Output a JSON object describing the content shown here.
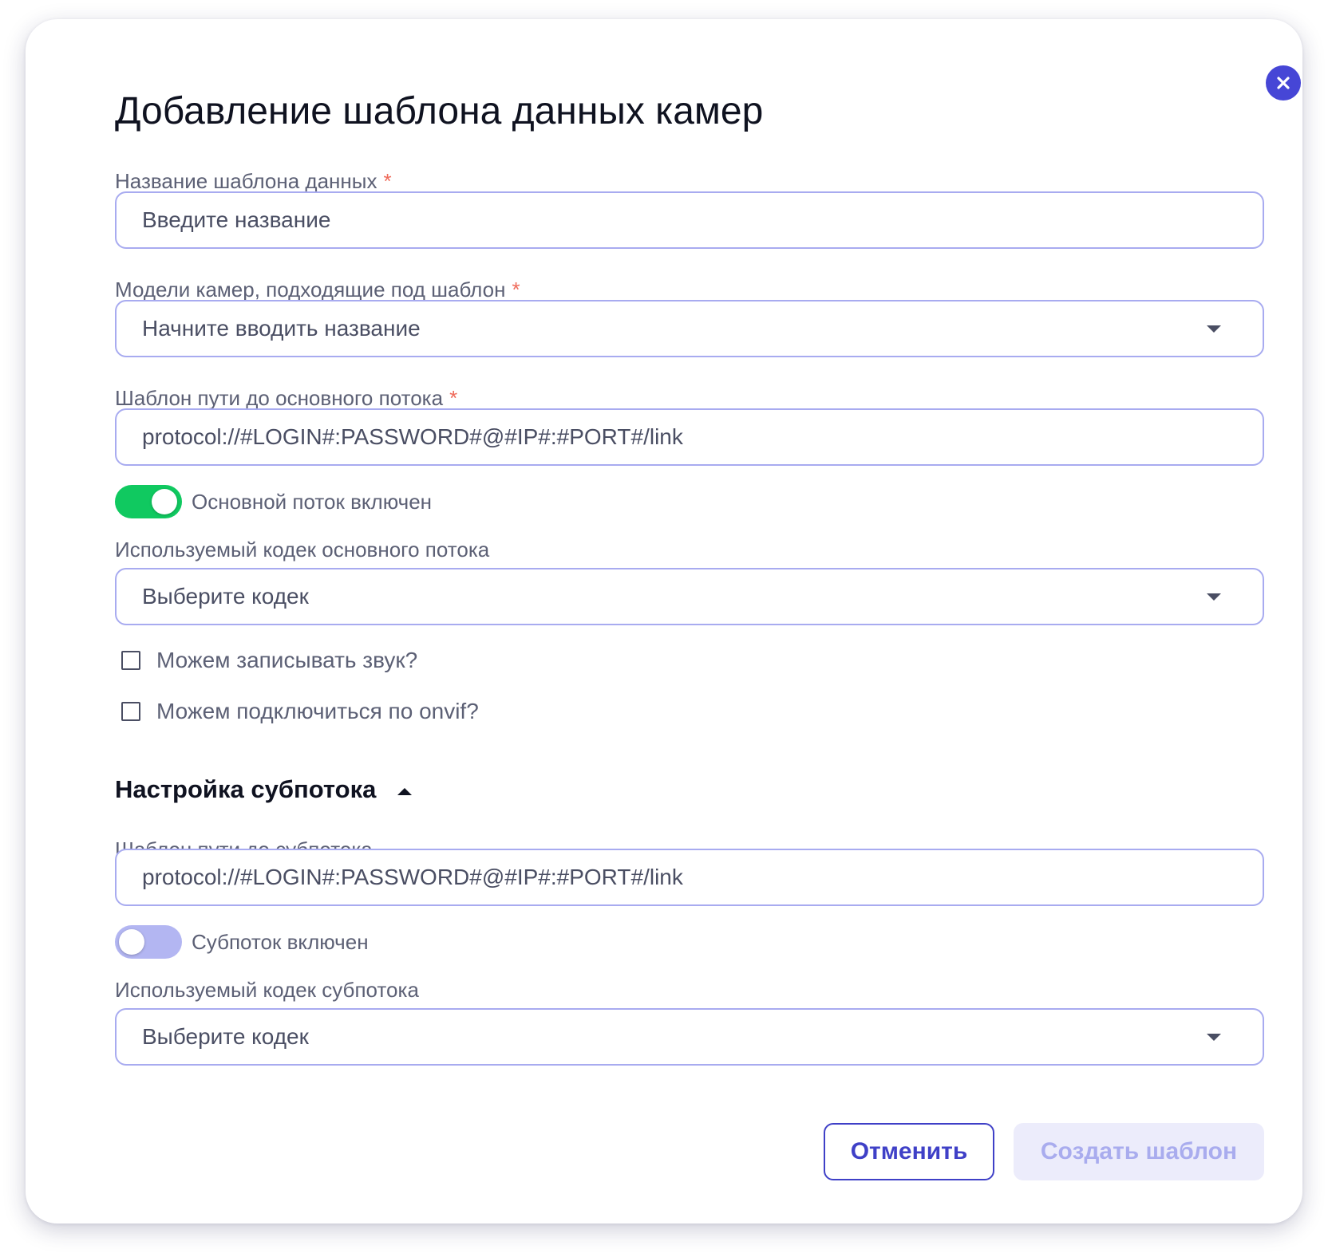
{
  "dialog": {
    "title": "Добавление шаблона данных камер",
    "accent_color": "#4646d6"
  },
  "fields": {
    "template_name": {
      "label": "Название шаблона данных",
      "required_mark": "*",
      "placeholder": "Введите название"
    },
    "camera_models": {
      "label": "Модели камер, подходящие под шаблон",
      "required_mark": "*",
      "placeholder": "Начните вводить название"
    },
    "main_stream_path": {
      "label": "Шаблон пути до основного потока",
      "required_mark": "*",
      "placeholder": "protocol://#LOGIN#:PASSWORD#@#IP#:#PORT#/link"
    },
    "main_stream_toggle": {
      "label": "Основной поток включен",
      "state": "on"
    },
    "main_codec": {
      "label": "Используемый кодек основного потока",
      "placeholder": "Выберите кодек"
    },
    "record_sound": {
      "label": "Можем записывать звук?",
      "checked": false
    },
    "onvif": {
      "label": "Можем подключиться по onvif?",
      "checked": false
    }
  },
  "substream_section": {
    "title": "Настройка субпотока",
    "expanded": true,
    "path": {
      "label": "Шаблон пути до субпотока",
      "placeholder": "protocol://#LOGIN#:PASSWORD#@#IP#:#PORT#/link"
    },
    "toggle": {
      "label": "Субпоток включен",
      "state": "off"
    },
    "codec": {
      "label": "Используемый кодек субпотока",
      "placeholder": "Выберите кодек"
    }
  },
  "actions": {
    "cancel_label": "Отменить",
    "create_label": "Создать шаблон",
    "create_disabled": true
  }
}
